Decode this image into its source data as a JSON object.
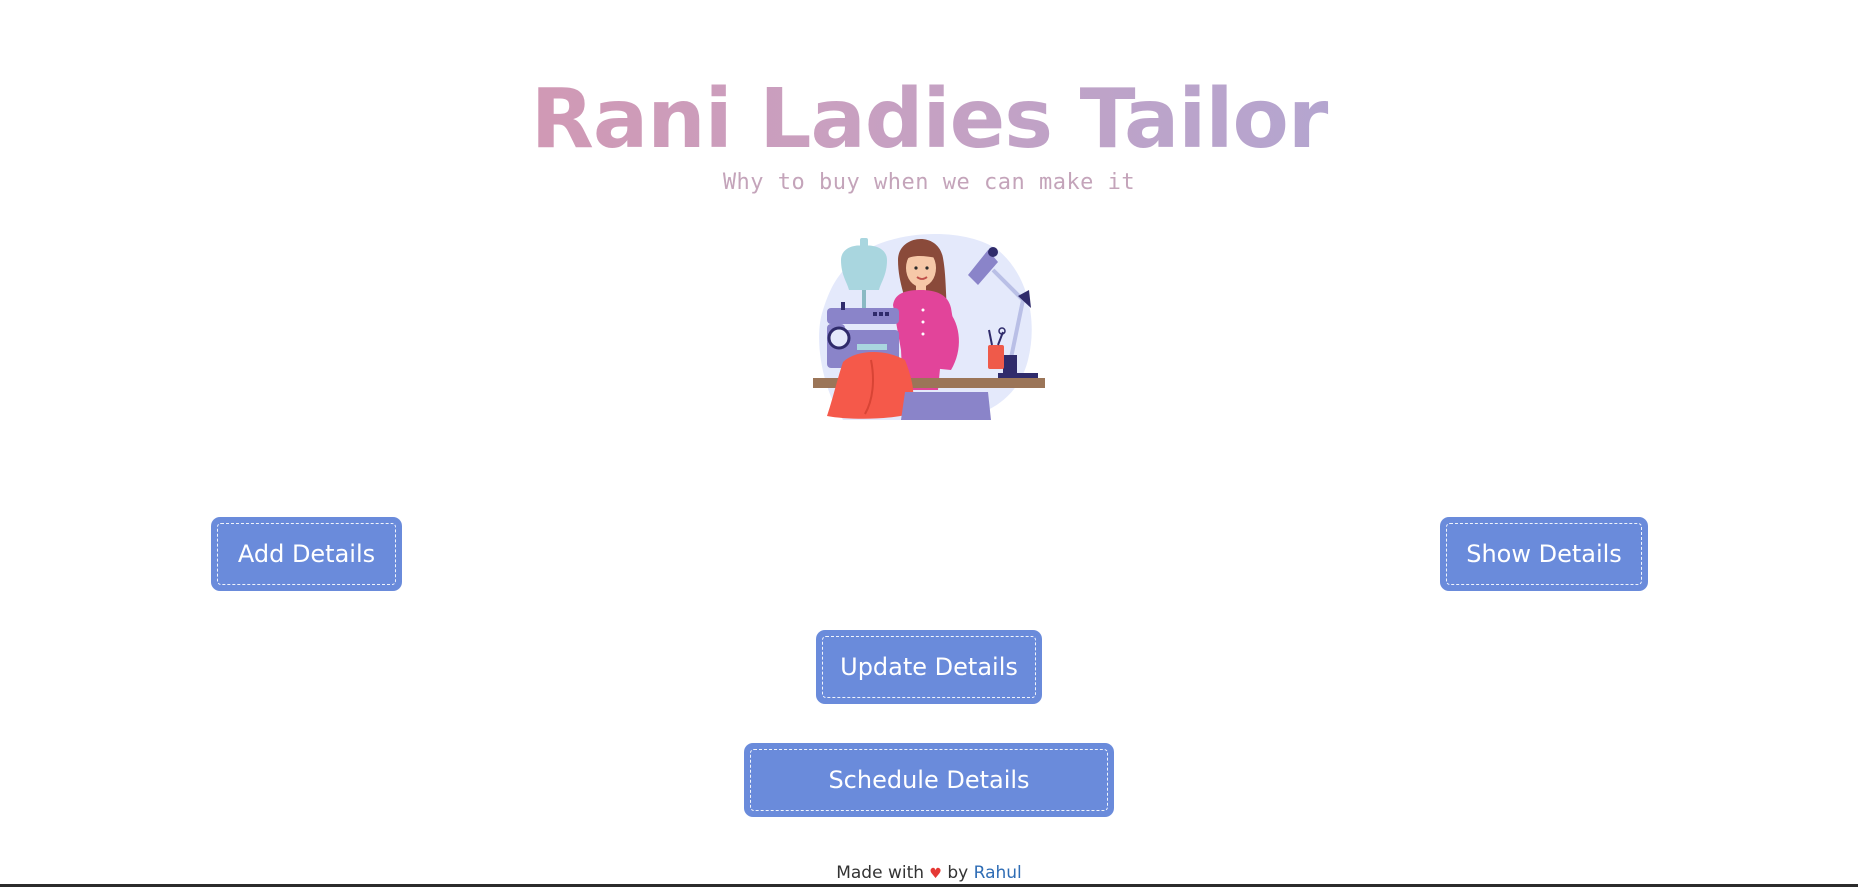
{
  "header": {
    "title": "Rani Ladies Tailor",
    "tagline": "Why to buy when we can make it"
  },
  "actions": {
    "add_label": "Add Details",
    "show_label": "Show Details",
    "update_label": "Update Details",
    "schedule_label": "Schedule Details"
  },
  "footer": {
    "prefix": "Made with",
    "heart": "♥",
    "by": "by",
    "author": "Rahul"
  },
  "colors": {
    "button_bg": "#6a8bdb",
    "title_gradient_start": "#dd8ca0",
    "title_gradient_end": "#9eabe0",
    "tagline": "#c4a4ba",
    "author_link": "#2f6db5",
    "heart": "#e53935"
  },
  "illustration": {
    "icon": "tailor-woman-sewing-illustration"
  }
}
